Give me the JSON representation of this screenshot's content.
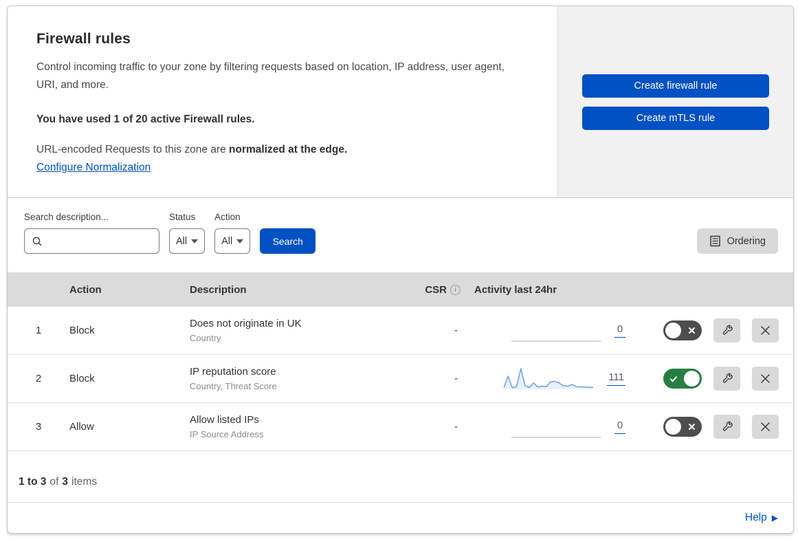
{
  "header": {
    "title": "Firewall rules",
    "description": "Control incoming traffic to your zone by filtering requests based on location, IP address, user agent, URI, and more.",
    "usage_line": "You have used 1 of 20 active Firewall rules.",
    "normalization_prefix": "URL-encoded Requests to this zone are ",
    "normalization_bold": "normalized at the edge.",
    "normalization_link": "Configure Normalization",
    "create_firewall_rule_label": "Create firewall rule",
    "create_mtls_rule_label": "Create mTLS rule"
  },
  "filters": {
    "search_label": "Search description...",
    "status_label": "Status",
    "status_value": "All",
    "action_label": "Action",
    "action_value": "All",
    "search_button_label": "Search",
    "ordering_button_label": "Ordering"
  },
  "table": {
    "columns": {
      "action": "Action",
      "description": "Description",
      "csr": "CSR",
      "activity": "Activity last 24hr"
    },
    "rows": [
      {
        "priority": "1",
        "action": "Block",
        "description": "Does not originate in UK",
        "fields": "Country",
        "csr": "-",
        "activity_count": "0",
        "enabled": false,
        "sparkline": [
          0,
          0,
          0,
          0,
          0,
          0,
          0,
          0,
          0,
          0,
          0,
          0,
          0,
          0,
          0,
          0,
          0,
          0,
          0,
          0,
          0,
          0
        ]
      },
      {
        "priority": "2",
        "action": "Block",
        "description": "IP reputation score",
        "fields": "Country, Threat Score",
        "csr": "-",
        "activity_count": "111",
        "enabled": true,
        "sparkline": [
          4,
          62,
          4,
          10,
          100,
          14,
          6,
          28,
          8,
          12,
          10,
          34,
          36,
          28,
          14,
          12,
          20,
          10,
          8,
          8,
          6,
          6
        ]
      },
      {
        "priority": "3",
        "action": "Allow",
        "description": "Allow listed IPs",
        "fields": "IP Source Address",
        "csr": "-",
        "activity_count": "0",
        "enabled": false,
        "sparkline": [
          0,
          0,
          0,
          0,
          0,
          0,
          0,
          0,
          0,
          0,
          0,
          0,
          0,
          0,
          0,
          0,
          0,
          0,
          0,
          0,
          0,
          0
        ]
      }
    ],
    "summary": {
      "range": "1 to 3",
      "of": "of",
      "total": "3",
      "items": "items"
    }
  },
  "footer": {
    "help_label": "Help"
  },
  "colors": {
    "accent_blue": "#0051c3",
    "toggle_on_green": "#287e42",
    "toggle_off_gray": "#4d4d4d",
    "sparkline_blue": "#6e9fe3",
    "sparkline_fill": "rgba(110,159,227,0.16)",
    "flat_line_gray": "#adadad"
  }
}
